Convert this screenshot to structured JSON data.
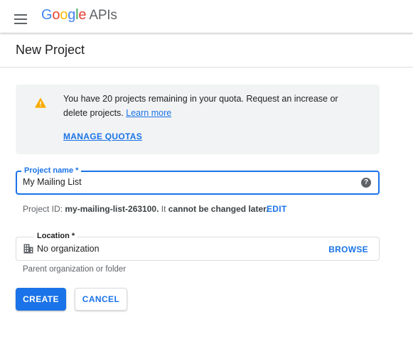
{
  "header": {
    "logo_letters": [
      {
        "char": "G",
        "color": "#4285f4"
      },
      {
        "char": "o",
        "color": "#ea4335"
      },
      {
        "char": "o",
        "color": "#fbbc05"
      },
      {
        "char": "g",
        "color": "#4285f4"
      },
      {
        "char": "l",
        "color": "#34a853"
      },
      {
        "char": "e",
        "color": "#ea4335"
      }
    ],
    "logo_suffix": "APIs",
    "menu_icon": "hamburger-menu-icon"
  },
  "page": {
    "title": "New Project"
  },
  "quota": {
    "icon": "warning-icon",
    "message": "You have 20 projects remaining in your quota. Request an increase or delete projects.",
    "learn_more": "Learn more",
    "manage_quotas": "MANAGE QUOTAS"
  },
  "project_name": {
    "label": "Project name *",
    "value": "My Mailing List",
    "help_icon": "help-icon"
  },
  "project_id": {
    "prefix": "Project ID:",
    "id": "my-mailing-list-263100.",
    "middle": "It",
    "warning": "cannot be changed later.",
    "edit": "EDIT"
  },
  "location": {
    "label": "Location *",
    "icon": "building-icon",
    "value": "No organization",
    "browse": "BROWSE",
    "helper": "Parent organization or folder"
  },
  "actions": {
    "create": "CREATE",
    "cancel": "CANCEL"
  },
  "colors": {
    "accent": "#1a73e8",
    "info_box_bg": "#f1f3f4",
    "warning": "#f9ab00"
  }
}
